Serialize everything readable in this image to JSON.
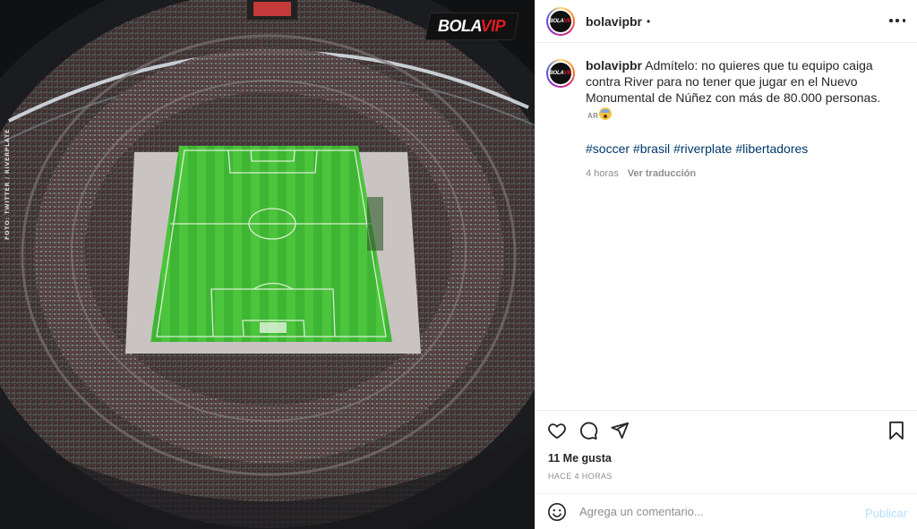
{
  "media": {
    "brand_badge": {
      "part_a": "BOLA",
      "part_b": "VIP"
    },
    "photo_credit": "FOTO: TWITTER / RIVERPLATE",
    "colors": {
      "pitch": "#3fb534",
      "pitch_stripe": "#4cc43c",
      "crowd": "#3a3636"
    }
  },
  "header": {
    "username": "bolavipbr",
    "dot": "•",
    "more_icon": "more-horizontal-icon"
  },
  "caption": {
    "username": "bolavipbr",
    "text": "Admítelo: no quieres que tu equipo caiga contra River para no tener que jugar en el Nuevo Monumental de Núñez con más de 80.000 personas.",
    "flag": "AR",
    "emoji": "scream-emoji",
    "hashtags": [
      "#soccer",
      "#brasil",
      "#riverplate",
      "#libertadores"
    ],
    "time": "4 horas",
    "translate_label": "Ver traducción"
  },
  "actions": {
    "icons": [
      "heart-icon",
      "comment-icon",
      "share-icon",
      "bookmark-icon"
    ],
    "likes": "11 Me gusta",
    "time_ago": "HACE 4 HORAS"
  },
  "comment": {
    "placeholder": "Agrega un comentario...",
    "publish_label": "Publicar",
    "emoji_icon": "smile-icon"
  }
}
